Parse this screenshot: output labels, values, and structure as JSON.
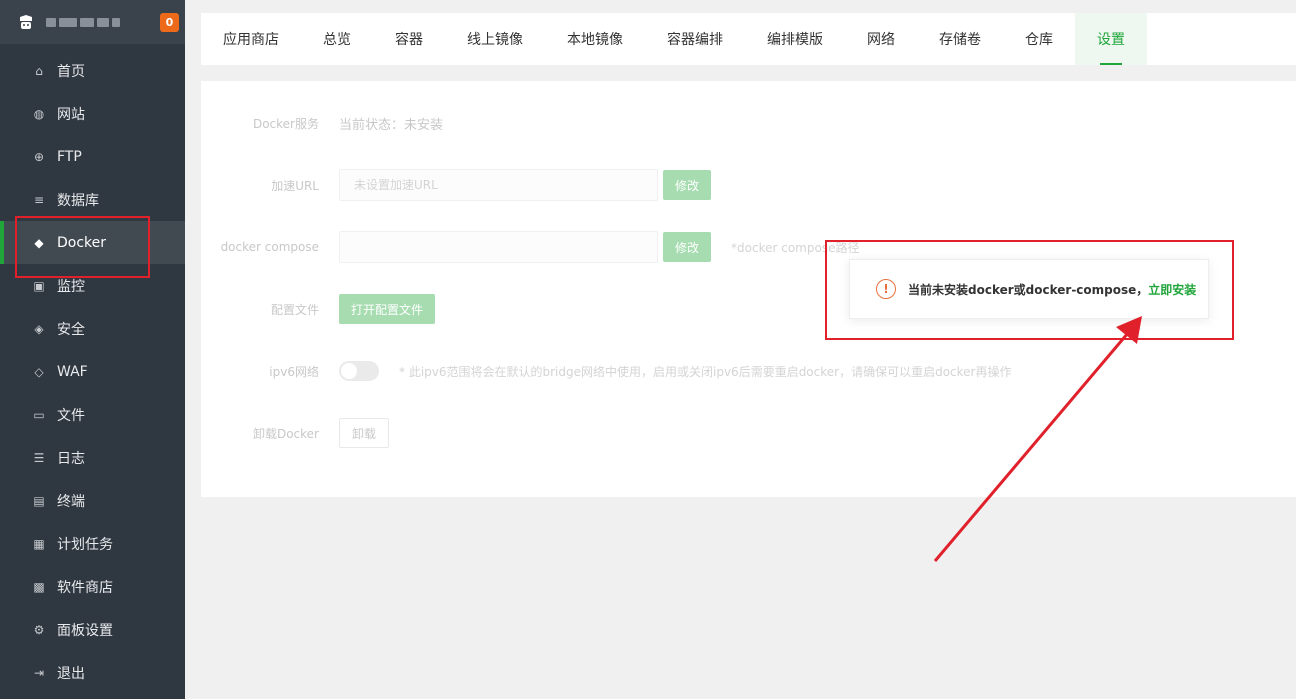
{
  "sidebar": {
    "badge": "0",
    "items": [
      {
        "label": "首页",
        "icon": "home-icon",
        "glyph": "⌂"
      },
      {
        "label": "网站",
        "icon": "globe-icon",
        "glyph": "◍"
      },
      {
        "label": "FTP",
        "icon": "ftp-globe-icon",
        "glyph": "⊕"
      },
      {
        "label": "数据库",
        "icon": "database-icon",
        "glyph": "≡"
      },
      {
        "label": "Docker",
        "icon": "docker-whale-icon",
        "glyph": "◆",
        "active": true
      },
      {
        "label": "监控",
        "icon": "monitor-icon",
        "glyph": "▣"
      },
      {
        "label": "安全",
        "icon": "shield-icon",
        "glyph": "◈"
      },
      {
        "label": "WAF",
        "icon": "waf-shield-icon",
        "glyph": "◇"
      },
      {
        "label": "文件",
        "icon": "folder-icon",
        "glyph": "▭"
      },
      {
        "label": "日志",
        "icon": "log-icon",
        "glyph": "☰"
      },
      {
        "label": "终端",
        "icon": "terminal-icon",
        "glyph": "▤"
      },
      {
        "label": "计划任务",
        "icon": "calendar-icon",
        "glyph": "▦"
      },
      {
        "label": "软件商店",
        "icon": "apps-grid-icon",
        "glyph": "▩"
      },
      {
        "label": "面板设置",
        "icon": "gear-icon",
        "glyph": "⚙"
      },
      {
        "label": "退出",
        "icon": "logout-icon",
        "glyph": "⇥"
      }
    ]
  },
  "tabs": [
    "应用商店",
    "总览",
    "容器",
    "线上镜像",
    "本地镜像",
    "容器编排",
    "编排模版",
    "网络",
    "存储卷",
    "仓库",
    "设置"
  ],
  "active_tab": "设置",
  "settings": {
    "docker_service": {
      "label": "Docker服务",
      "value": "当前状态：未安装"
    },
    "accel_url": {
      "label": "加速URL",
      "placeholder": "未设置加速URL",
      "button": "修改"
    },
    "compose": {
      "label": "docker compose",
      "placeholder": "",
      "button": "修改",
      "hint": "*docker compose路径"
    },
    "config_file": {
      "label": "配置文件",
      "button": "打开配置文件"
    },
    "ipv6": {
      "label": "ipv6网络",
      "enabled": false,
      "hint": "* 此ipv6范围将会在默认的bridge网络中使用，启用或关闭ipv6后需要重启docker，请确保可以重启docker再操作"
    },
    "uninstall": {
      "label": "卸载Docker",
      "button": "卸载"
    }
  },
  "alert": {
    "icon": "warning-circle-icon",
    "glyph": "!",
    "message": "当前未安装docker或docker-compose，",
    "link": "立即安装"
  },
  "colors": {
    "accent": "#20a53a",
    "sidebar_bg": "#2f3740",
    "annotation_red": "#e0202a",
    "badge": "#ee6a1b"
  }
}
